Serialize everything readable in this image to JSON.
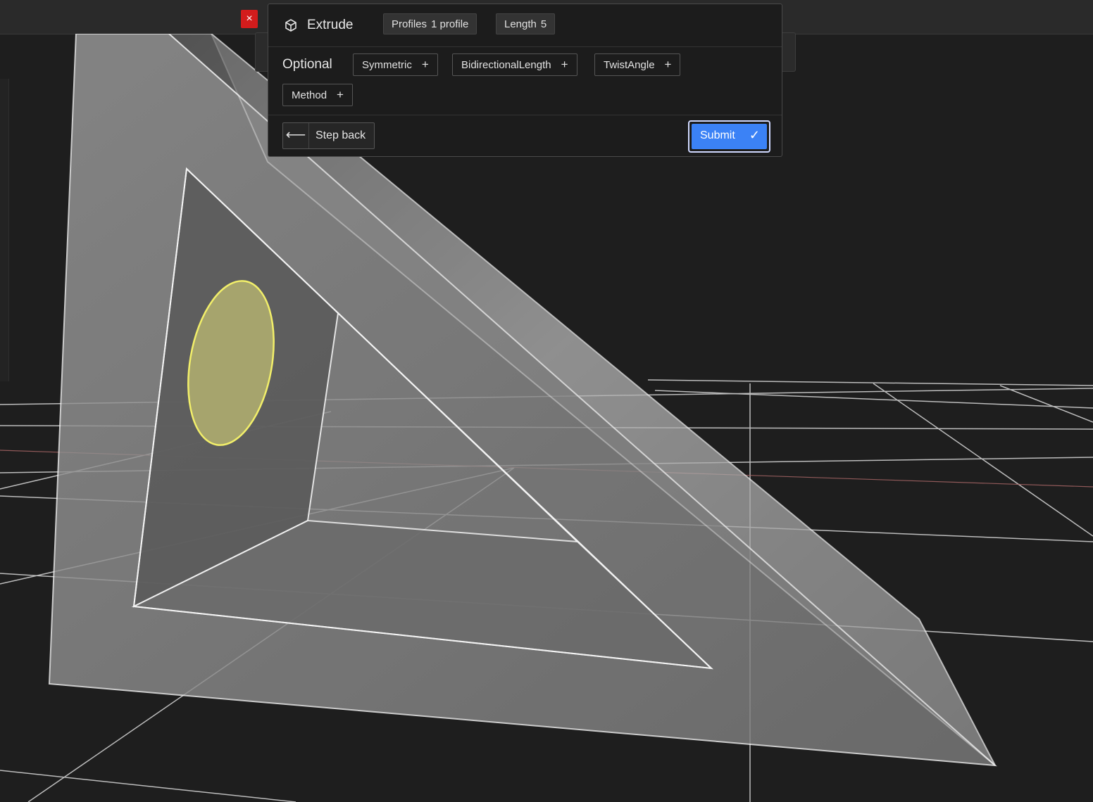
{
  "toolbar": {
    "close_symbol": "×"
  },
  "panel": {
    "icon": "cube-icon",
    "title": "Extrude",
    "params": [
      {
        "label": "Profiles",
        "value": "1 profile"
      },
      {
        "label": "Length",
        "value": "5"
      }
    ],
    "optional_label": "Optional",
    "optional_params": [
      {
        "label": "Symmetric",
        "add_symbol": "+"
      },
      {
        "label": "BidirectionalLength",
        "add_symbol": "+"
      },
      {
        "label": "TwistAngle",
        "add_symbol": "+"
      },
      {
        "label": "Method",
        "add_symbol": "+"
      }
    ],
    "step_back_label": "Step back",
    "step_back_arrow": "⟵",
    "submit_label": "Submit",
    "submit_check": "✓"
  },
  "colors": {
    "accent": "#3b82f6",
    "close_red": "#d31c1c",
    "selected_profile": "#e8e48a"
  }
}
